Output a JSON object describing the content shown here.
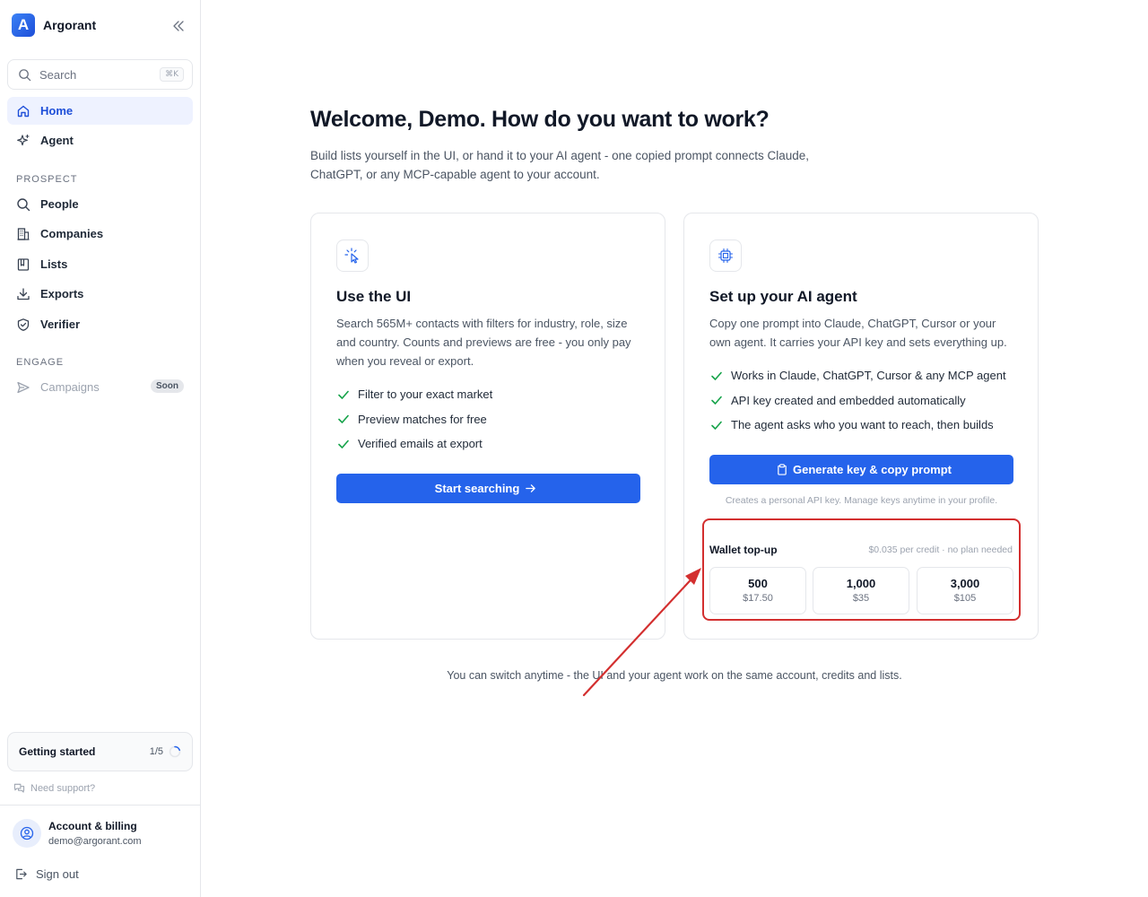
{
  "app": {
    "name": "Argorant",
    "logo_letter": "A"
  },
  "sidebar": {
    "search": {
      "label": "Search",
      "shortcut": "⌘K"
    },
    "nav": [
      {
        "label": "Home",
        "icon": "home-icon",
        "active": true
      },
      {
        "label": "Agent",
        "icon": "sparkles-icon"
      }
    ],
    "sections": [
      {
        "title": "PROSPECT",
        "items": [
          {
            "label": "People",
            "icon": "search-icon"
          },
          {
            "label": "Companies",
            "icon": "building-icon"
          },
          {
            "label": "Lists",
            "icon": "book-icon"
          },
          {
            "label": "Exports",
            "icon": "download-icon"
          },
          {
            "label": "Verifier",
            "icon": "shield-check-icon"
          }
        ]
      },
      {
        "title": "ENGAGE",
        "items": [
          {
            "label": "Campaigns",
            "icon": "send-icon",
            "badge": "Soon",
            "disabled": true
          }
        ]
      }
    ],
    "getting_started": {
      "label": "Getting started",
      "progress": "1/5"
    },
    "support": {
      "label": "Need support?"
    },
    "account": {
      "title": "Account & billing",
      "email": "demo@argorant.com"
    },
    "signout": {
      "label": "Sign out"
    }
  },
  "main": {
    "heading": "Welcome, Demo. How do you want to work?",
    "subheading": "Build lists yourself in the UI, or hand it to your AI agent - one copied prompt connects Claude, ChatGPT, or any MCP-capable agent to your account.",
    "cards": [
      {
        "icon": "cursor-click-icon",
        "title": "Use the UI",
        "description": "Search 565M+ contacts with filters for industry, role, size and country. Counts and previews are free - you only pay when you reveal or export.",
        "features": [
          "Filter to your exact market",
          "Preview matches for free",
          "Verified emails at export"
        ],
        "button": "Start searching"
      },
      {
        "icon": "cpu-chip-icon",
        "title": "Set up your AI agent",
        "description": "Copy one prompt into Claude, ChatGPT, Cursor or your own agent. It carries your API key and sets everything up.",
        "features": [
          "Works in Claude, ChatGPT, Cursor & any MCP agent",
          "API key created and embedded automatically",
          "The agent asks who you want to reach, then builds"
        ],
        "button": "Generate key & copy prompt",
        "hint": "Creates a personal API key. Manage keys anytime in your profile.",
        "wallet": {
          "title": "Wallet top-up",
          "note": "$0.035 per credit · no plan needed",
          "options": [
            {
              "credits": "500",
              "price": "$17.50"
            },
            {
              "credits": "1,000",
              "price": "$35"
            },
            {
              "credits": "3,000",
              "price": "$105"
            }
          ]
        }
      }
    ],
    "footer_note": "You can switch anytime - the UI and your agent work on the same account, credits and lists."
  },
  "colors": {
    "primary": "#2563eb",
    "accent_light": "#eef2ff",
    "check": "#16a34a",
    "annotation": "#d32f2f"
  }
}
